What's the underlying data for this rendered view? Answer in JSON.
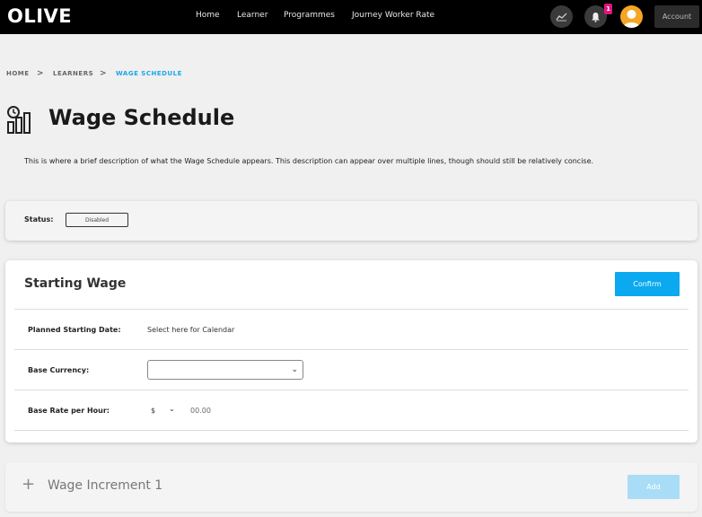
{
  "header": {
    "logo": "OLIVE",
    "nav": [
      "Home",
      "Learner",
      "Programmes",
      "Journey Worker Rate"
    ],
    "notification_count": "1",
    "account_label": "Account"
  },
  "breadcrumb": {
    "home": "HOME",
    "learners": "LEARNERS",
    "current": "WAGE SCHEDULE",
    "separator": ">"
  },
  "page": {
    "title": "Wage Schedule",
    "description": "This is where a brief description of what the Wage Schedule appears. This description can appear over multiple lines, though should still be relatively concise."
  },
  "status": {
    "label": "Status:",
    "value": "Disabled"
  },
  "starting_wage": {
    "title": "Starting Wage",
    "confirm_label": "Confirm",
    "planned_date_label": "Planned Starting Date:",
    "planned_date_placeholder": "Select here for Calendar",
    "base_currency_label": "Base Currency:",
    "base_currency_value": "",
    "base_rate_label": "Base Rate per Hour:",
    "currency_symbol": "$",
    "rate_placeholder": "00.00"
  },
  "increment": {
    "title": "Wage Increment 1",
    "add_label": "Add"
  },
  "colors": {
    "accent": "#0aa9f0",
    "badge": "#e0157a",
    "avatar": "#f6a623"
  }
}
